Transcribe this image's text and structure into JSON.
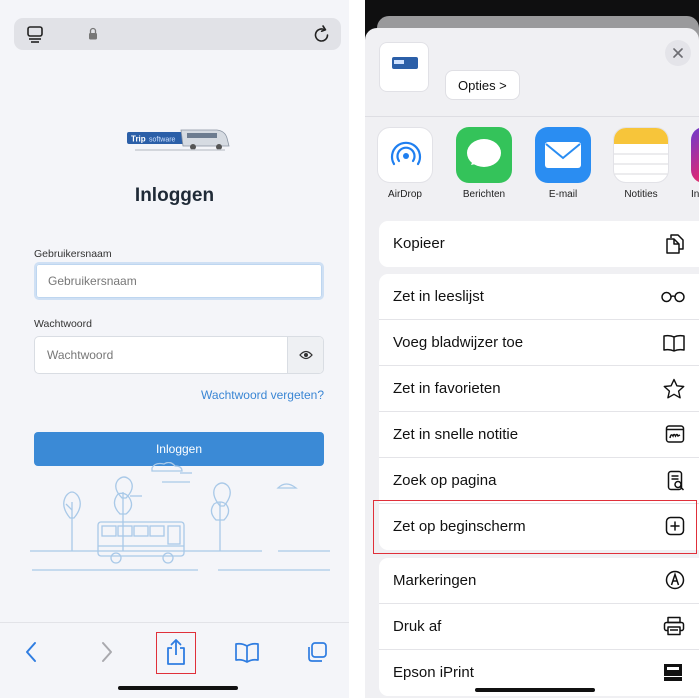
{
  "left_phone": {
    "login": {
      "title": "Inloggen",
      "username_label": "Gebruikersnaam",
      "username_placeholder": "Gebruikersnaam",
      "password_label": "Wachtwoord",
      "password_placeholder": "Wachtwoord",
      "forgot_link": "Wachtwoord vergeten?",
      "submit": "Inloggen"
    },
    "toolbar_icons": [
      "back-icon",
      "forward-icon",
      "share-icon",
      "bookmarks-icon",
      "tabs-icon"
    ]
  },
  "share_sheet": {
    "options_button": "Opties >",
    "apps": [
      {
        "label": "AirDrop",
        "icon": "airdrop-icon"
      },
      {
        "label": "Berichten",
        "icon": "messages-icon"
      },
      {
        "label": "E-mail",
        "icon": "mail-icon"
      },
      {
        "label": "Notities",
        "icon": "notes-icon"
      },
      {
        "label": "In",
        "icon": "instagram-icon"
      }
    ],
    "actions_group1": [
      {
        "label": "Kopieer",
        "icon": "copy-icon"
      }
    ],
    "actions_group2": [
      {
        "label": "Zet in leeslijst",
        "icon": "glasses-icon"
      },
      {
        "label": "Voeg bladwijzer toe",
        "icon": "book-icon"
      },
      {
        "label": "Zet in favorieten",
        "icon": "star-icon"
      },
      {
        "label": "Zet in snelle notitie",
        "icon": "quick-note-icon"
      },
      {
        "label": "Zoek op pagina",
        "icon": "find-on-page-icon"
      },
      {
        "label": "Zet op beginscherm",
        "icon": "add-square-icon"
      }
    ],
    "actions_group3": [
      {
        "label": "Markeringen",
        "icon": "markup-icon"
      },
      {
        "label": "Druk af",
        "icon": "printer-icon"
      },
      {
        "label": "Epson iPrint",
        "icon": "epson-icon"
      }
    ],
    "colors": {
      "highlight": "#e0303a",
      "login_button": "#3b8ad6",
      "link": "#3a86d4"
    }
  }
}
